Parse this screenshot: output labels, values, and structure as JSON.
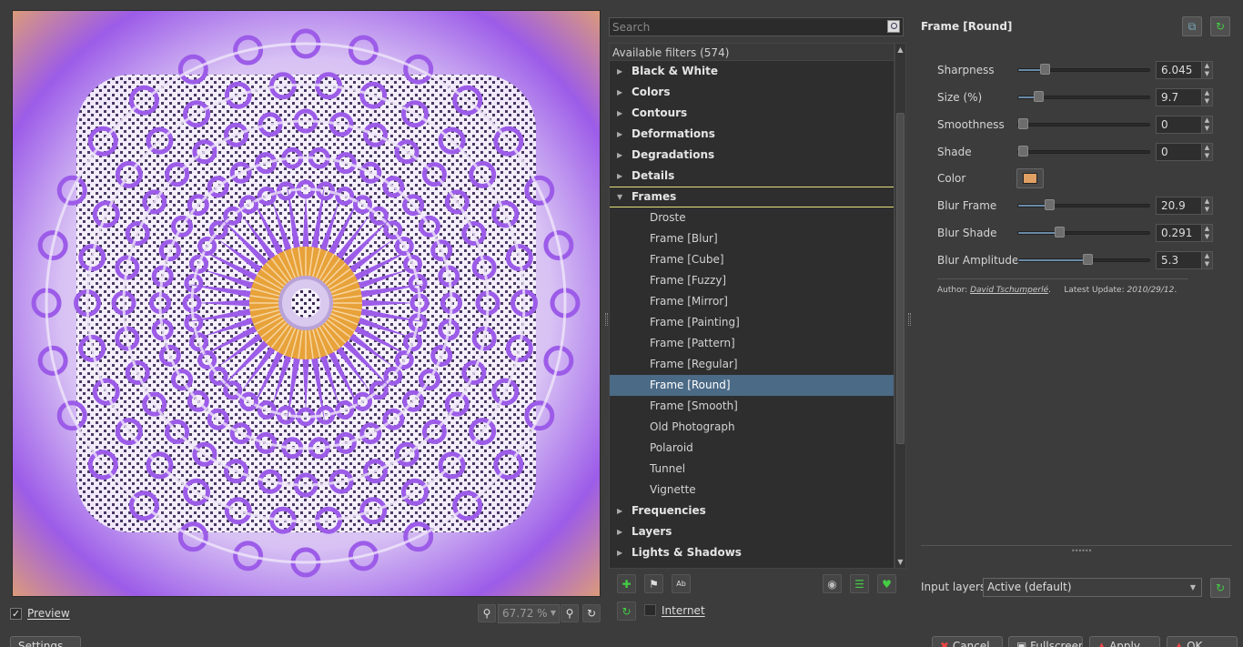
{
  "preview": {
    "checkbox_checked": true,
    "check_glyph": "✓",
    "label": "Preview",
    "zoom_value": "67.72 %",
    "colors": {
      "purple": "#9c5ce8",
      "orange": "#e1a070",
      "center_orange": "#e8a23a"
    }
  },
  "filter_list": {
    "search_placeholder": "Search",
    "header": "Available filters (574)",
    "items": [
      {
        "label": "Black & White",
        "type": "category",
        "expanded": false
      },
      {
        "label": "Colors",
        "type": "category",
        "expanded": false
      },
      {
        "label": "Contours",
        "type": "category",
        "expanded": false
      },
      {
        "label": "Deformations",
        "type": "category",
        "expanded": false
      },
      {
        "label": "Degradations",
        "type": "category",
        "expanded": false
      },
      {
        "label": "Details",
        "type": "category",
        "expanded": false
      },
      {
        "label": "Frames",
        "type": "category",
        "expanded": true,
        "focused": true
      },
      {
        "label": "Droste",
        "type": "child"
      },
      {
        "label": "Frame [Blur]",
        "type": "child"
      },
      {
        "label": "Frame [Cube]",
        "type": "child"
      },
      {
        "label": "Frame [Fuzzy]",
        "type": "child"
      },
      {
        "label": "Frame [Mirror]",
        "type": "child"
      },
      {
        "label": "Frame [Painting]",
        "type": "child"
      },
      {
        "label": "Frame [Pattern]",
        "type": "child"
      },
      {
        "label": "Frame [Regular]",
        "type": "child"
      },
      {
        "label": "Frame [Round]",
        "type": "child",
        "selected": true
      },
      {
        "label": "Frame [Smooth]",
        "type": "child"
      },
      {
        "label": "Old Photograph",
        "type": "child"
      },
      {
        "label": "Polaroid",
        "type": "child"
      },
      {
        "label": "Tunnel",
        "type": "child"
      },
      {
        "label": "Vignette",
        "type": "child"
      },
      {
        "label": "Frequencies",
        "type": "category",
        "expanded": false
      },
      {
        "label": "Layers",
        "type": "category",
        "expanded": false
      },
      {
        "label": "Lights & Shadows",
        "type": "category",
        "expanded": false
      }
    ],
    "internet_label": "Internet",
    "internet_checked": false
  },
  "params": {
    "title": "Frame [Round]",
    "sliders": [
      {
        "label": "Sharpness",
        "value": "6.045",
        "fraction": 0.18
      },
      {
        "label": "Size (%)",
        "value": "9.7",
        "fraction": 0.13
      },
      {
        "label": "Smoothness",
        "value": "0",
        "fraction": 0.0
      },
      {
        "label": "Shade",
        "value": "0",
        "fraction": 0.0
      },
      {
        "label": "Blur Frame",
        "value": "20.9",
        "fraction": 0.22
      },
      {
        "label": "Blur Shade",
        "value": "0.291",
        "fraction": 0.3
      },
      {
        "label": "Blur Amplitude",
        "value": "5.3",
        "fraction": 0.53
      }
    ],
    "color": {
      "label": "Color",
      "value": "#e0a064"
    },
    "author_prefix": "Author:",
    "author_name": "David Tschumperlé",
    "author_suffix": ".",
    "update_prefix": "Latest Update:",
    "update_date": "2010/29/12",
    "update_suffix": ".",
    "input_layers_label": "Input layers",
    "input_layers_value": "Active (default)"
  },
  "bottom_buttons": {
    "settings": "Settings",
    "cancel": "Cancel",
    "fullscreen": "Fullscreen",
    "apply": "Apply",
    "ok": "OK"
  }
}
